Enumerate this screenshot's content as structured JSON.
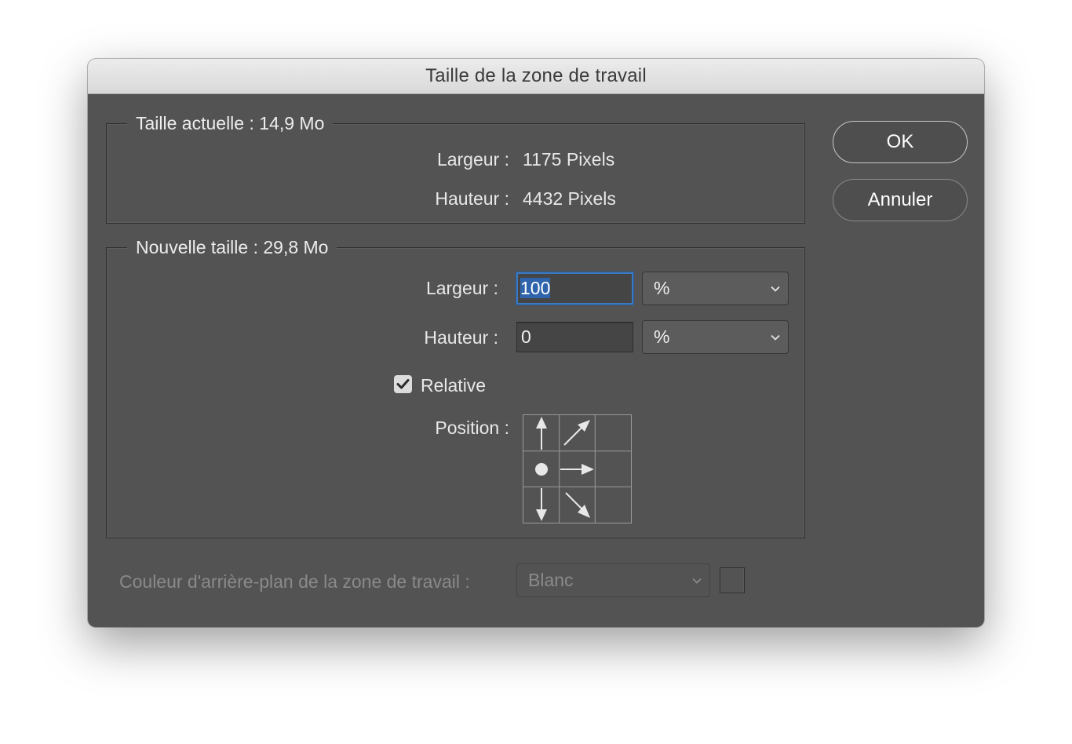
{
  "dialog": {
    "title": "Taille de la zone de travail"
  },
  "current_size": {
    "legend": "Taille actuelle : 14,9 Mo",
    "width_label": "Largeur :",
    "width_value": "1175 Pixels",
    "height_label": "Hauteur :",
    "height_value": "4432 Pixels"
  },
  "new_size": {
    "legend": "Nouvelle taille : 29,8 Mo",
    "width_label": "Largeur :",
    "width_value": "100",
    "width_unit": "%",
    "height_label": "Hauteur :",
    "height_value": "0",
    "height_unit": "%",
    "relative_label": "Relative",
    "relative_checked": true,
    "position_label": "Position :",
    "anchor": "middle-left"
  },
  "background": {
    "label": "Couleur d'arrière-plan de la zone de travail :",
    "value": "Blanc",
    "enabled": false
  },
  "buttons": {
    "ok": "OK",
    "cancel": "Annuler"
  },
  "colors": {
    "dialog_bg": "#535353",
    "focus_ring": "#3c79c0",
    "selection": "#2f64ad"
  }
}
